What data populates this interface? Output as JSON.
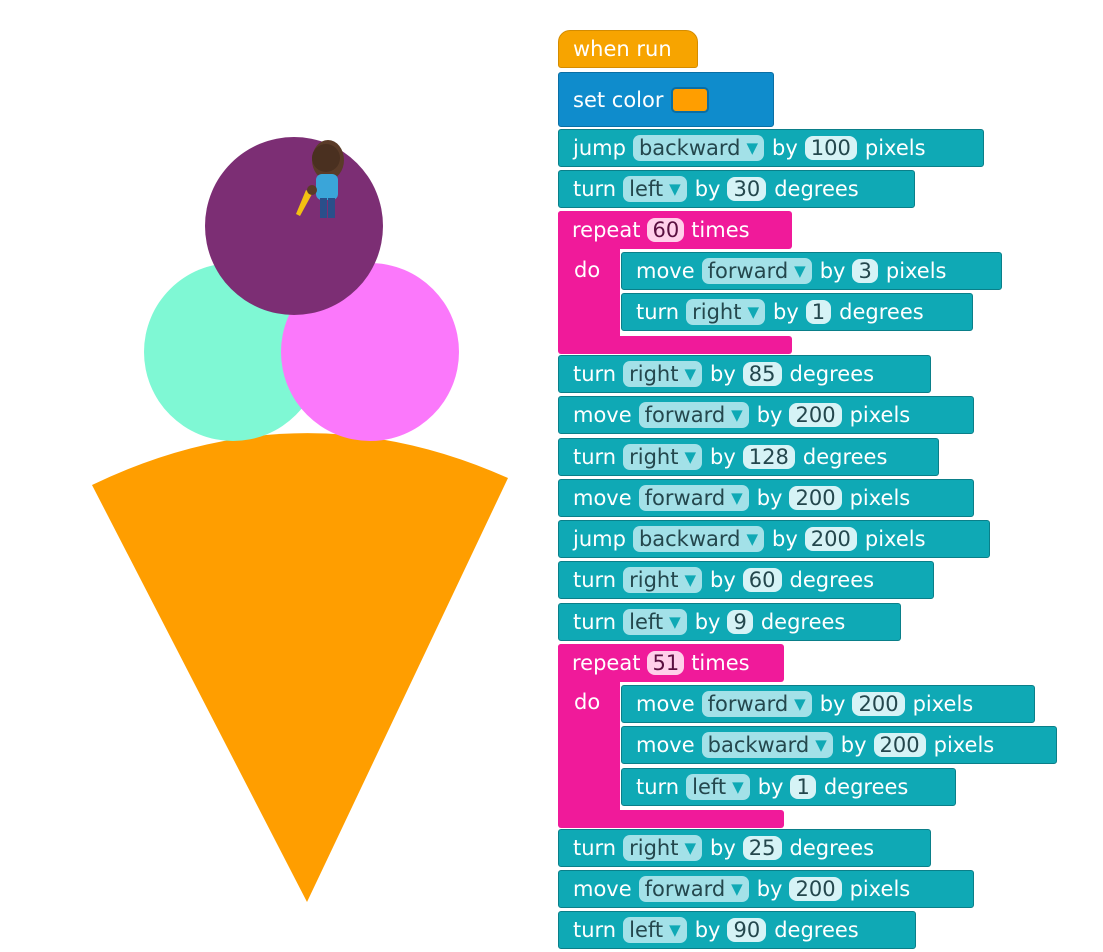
{
  "colors": {
    "cone": "#ff9e00",
    "scoop_top": "#7c2e74",
    "scoop_left": "#7ff8d4",
    "scoop_right": "#fb78fb",
    "block_teal": "#0fa9b5",
    "block_event": "#f7a400",
    "block_repeat": "#f01a9a",
    "block_color": "#0f8ccc"
  },
  "sprite": {
    "icon": "artist-character-icon"
  },
  "program": {
    "event": {
      "label": "when run"
    },
    "set_color": {
      "label": "set color",
      "value": "#ff9e00"
    },
    "b1": {
      "verb": "jump",
      "dir": "backward",
      "by": "by",
      "value": "100",
      "unit": "pixels"
    },
    "b2": {
      "verb": "turn",
      "dir": "left",
      "by": "by",
      "value": "30",
      "unit": "degrees"
    },
    "r1": {
      "repeat": "repeat",
      "count": "60",
      "times": "times",
      "do": "do",
      "c1": {
        "verb": "move",
        "dir": "forward",
        "by": "by",
        "value": "3",
        "unit": "pixels"
      },
      "c2": {
        "verb": "turn",
        "dir": "right",
        "by": "by",
        "value": "1",
        "unit": "degrees"
      }
    },
    "b3": {
      "verb": "turn",
      "dir": "right",
      "by": "by",
      "value": "85",
      "unit": "degrees"
    },
    "b4": {
      "verb": "move",
      "dir": "forward",
      "by": "by",
      "value": "200",
      "unit": "pixels"
    },
    "b5": {
      "verb": "turn",
      "dir": "right",
      "by": "by",
      "value": "128",
      "unit": "degrees"
    },
    "b6": {
      "verb": "move",
      "dir": "forward",
      "by": "by",
      "value": "200",
      "unit": "pixels"
    },
    "b7": {
      "verb": "jump",
      "dir": "backward",
      "by": "by",
      "value": "200",
      "unit": "pixels"
    },
    "b8": {
      "verb": "turn",
      "dir": "right",
      "by": "by",
      "value": "60",
      "unit": "degrees"
    },
    "b9": {
      "verb": "turn",
      "dir": "left",
      "by": "by",
      "value": "9",
      "unit": "degrees"
    },
    "r2": {
      "repeat": "repeat",
      "count": "51",
      "times": "times",
      "do": "do",
      "c1": {
        "verb": "move",
        "dir": "forward",
        "by": "by",
        "value": "200",
        "unit": "pixels"
      },
      "c2": {
        "verb": "move",
        "dir": "backward",
        "by": "by",
        "value": "200",
        "unit": "pixels"
      },
      "c3": {
        "verb": "turn",
        "dir": "left",
        "by": "by",
        "value": "1",
        "unit": "degrees"
      }
    },
    "b10": {
      "verb": "turn",
      "dir": "right",
      "by": "by",
      "value": "25",
      "unit": "degrees"
    },
    "b11": {
      "verb": "move",
      "dir": "forward",
      "by": "by",
      "value": "200",
      "unit": "pixels"
    },
    "b12": {
      "verb": "turn",
      "dir": "left",
      "by": "by",
      "value": "90",
      "unit": "degrees"
    }
  }
}
